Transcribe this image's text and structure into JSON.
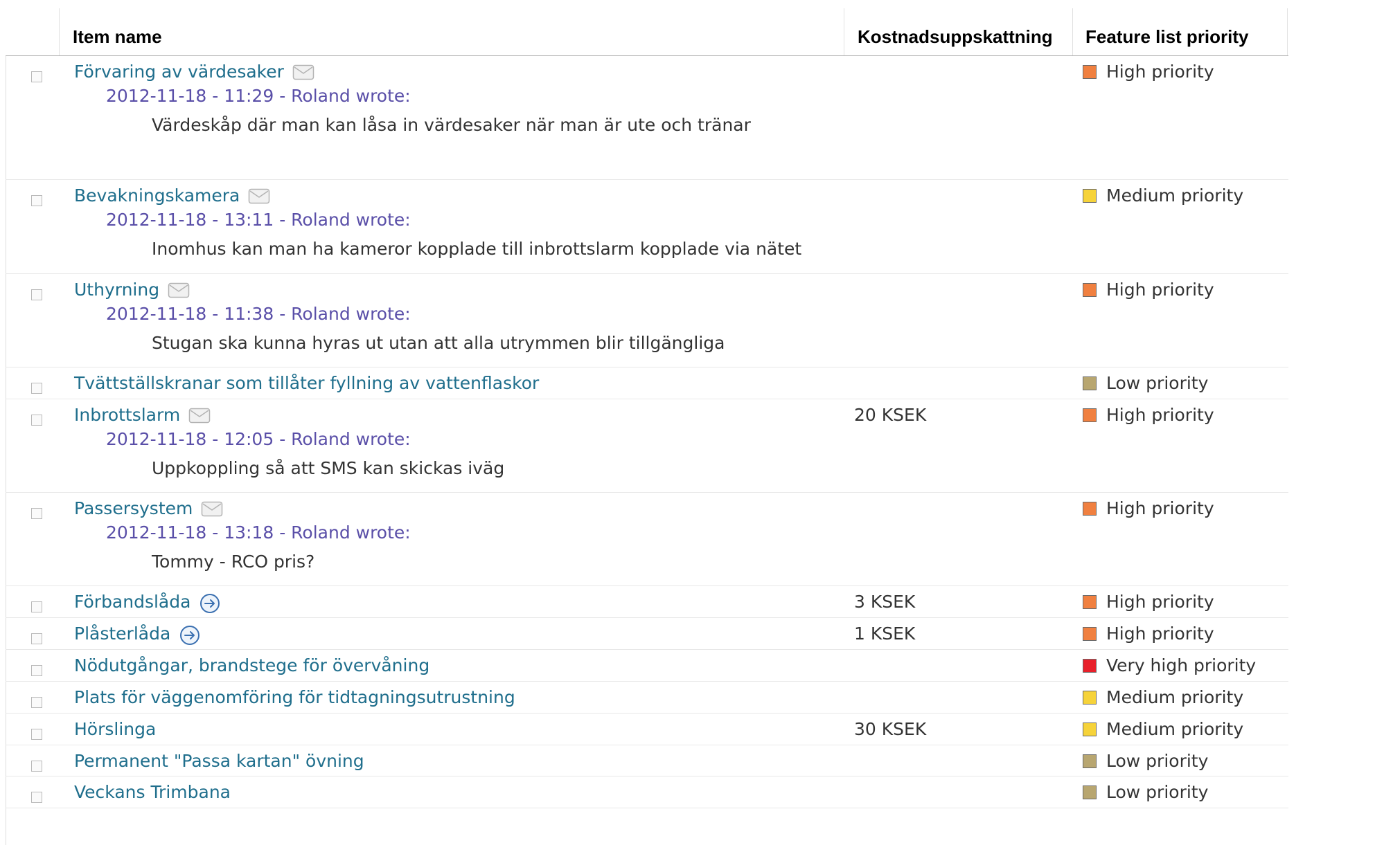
{
  "columns": {
    "item_name": "Item name",
    "cost": "Kostnadsuppskattning",
    "priority": "Feature list priority"
  },
  "priority_colors": {
    "High priority": "#f08040",
    "Medium priority": "#f6d33a",
    "Low priority": "#b8a670",
    "Very high priority": "#e8202a"
  },
  "items": [
    {
      "title": "Förvaring av värdesaker",
      "icon": "envelope-icon",
      "comment_header": "2012-11-18 - 11:29 - Roland wrote:",
      "comment_text": "Värdeskåp där man kan låsa in värdesaker när man är ute och tränar",
      "cost": "",
      "priority": "High priority"
    },
    {
      "title": "Bevakningskamera",
      "icon": "envelope-icon",
      "comment_header": "2012-11-18 - 13:11 - Roland wrote:",
      "comment_text": "Inomhus kan man ha kameror kopplade till inbrottslarm kopplade via nätet",
      "cost": "",
      "priority": "Medium priority"
    },
    {
      "title": "Uthyrning",
      "icon": "envelope-icon",
      "comment_header": "2012-11-18 - 11:38 - Roland wrote:",
      "comment_text": "Stugan ska kunna hyras ut utan att alla utrymmen blir tillgängliga",
      "cost": "",
      "priority": "High priority"
    },
    {
      "title": "Tvättställskranar som tillåter fyllning av vattenflaskor",
      "icon": "",
      "comment_header": "",
      "comment_text": "",
      "cost": "",
      "priority": "Low priority"
    },
    {
      "title": "Inbrottslarm",
      "icon": "envelope-icon",
      "comment_header": "2012-11-18 - 12:05 - Roland wrote:",
      "comment_text": "Uppkoppling så att SMS kan skickas iväg",
      "cost": "20 KSEK",
      "priority": "High priority"
    },
    {
      "title": "Passersystem",
      "icon": "envelope-icon",
      "comment_header": "2012-11-18 - 13:18 - Roland wrote:",
      "comment_text": "Tommy - RCO pris?",
      "cost": "",
      "priority": "High priority"
    },
    {
      "title": "Förbandslåda",
      "icon": "arrow-circle-icon",
      "comment_header": "",
      "comment_text": "",
      "cost": "3 KSEK",
      "priority": "High priority"
    },
    {
      "title": "Plåsterlåda",
      "icon": "arrow-circle-icon",
      "comment_header": "",
      "comment_text": "",
      "cost": "1 KSEK",
      "priority": "High priority"
    },
    {
      "title": "Nödutgångar, brandstege för övervåning",
      "icon": "",
      "comment_header": "",
      "comment_text": "",
      "cost": "",
      "priority": "Very high priority"
    },
    {
      "title": "Plats för väggenomföring för tidtagningsutrustning",
      "icon": "",
      "comment_header": "",
      "comment_text": "",
      "cost": "",
      "priority": "Medium priority"
    },
    {
      "title": "Hörslinga",
      "icon": "",
      "comment_header": "",
      "comment_text": "",
      "cost": "30 KSEK",
      "priority": "Medium priority"
    },
    {
      "title": "Permanent \"Passa kartan\" övning",
      "icon": "",
      "comment_header": "",
      "comment_text": "",
      "cost": "",
      "priority": "Low priority"
    },
    {
      "title": "Veckans Trimbana",
      "icon": "",
      "comment_header": "",
      "comment_text": "",
      "cost": "",
      "priority": "Low priority"
    }
  ]
}
